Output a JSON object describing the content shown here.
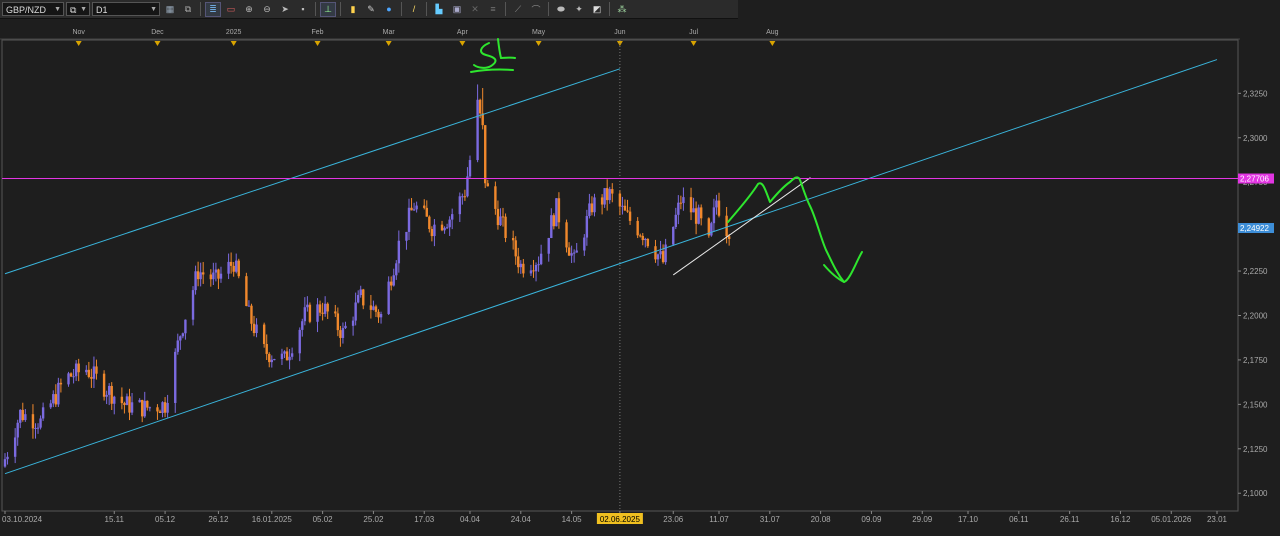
{
  "toolbar": {
    "symbol": "GBP/NZD",
    "timeframe": "D1",
    "buttons": [
      {
        "name": "chart-type-icon",
        "glyph": "▦",
        "color": "#9ab"
      },
      {
        "name": "link-icon",
        "glyph": "⧉",
        "color": "#aaa"
      },
      {
        "sep": true
      },
      {
        "name": "indicators-icon",
        "glyph": "≣",
        "color": "#6fa8dc",
        "active": true
      },
      {
        "name": "templates-icon",
        "glyph": "▭",
        "color": "#e06060"
      },
      {
        "name": "zoom-in-icon",
        "glyph": "⊕",
        "color": "#bbb"
      },
      {
        "name": "zoom-out-icon",
        "glyph": "⊖",
        "color": "#bbb"
      },
      {
        "name": "autoscroll-icon",
        "glyph": "➤",
        "color": "#bbb"
      },
      {
        "name": "grid-icon",
        "glyph": "▪",
        "color": "#bbb"
      },
      {
        "sep": true
      },
      {
        "name": "cursor-icon",
        "glyph": "⊥",
        "color": "#9f9",
        "active": true
      },
      {
        "sep": true
      },
      {
        "name": "text-icon",
        "glyph": "▮",
        "color": "#ffd24d"
      },
      {
        "name": "pencil-icon",
        "glyph": "✎",
        "color": "#ccc"
      },
      {
        "name": "globe-icon",
        "glyph": "●",
        "color": "#4da6ff"
      },
      {
        "sep": true
      },
      {
        "name": "brush-icon",
        "glyph": "/",
        "color": "#ffdd66"
      },
      {
        "sep": true
      },
      {
        "name": "trade-icon",
        "glyph": "▙",
        "color": "#6cf"
      },
      {
        "name": "window-icon",
        "glyph": "▣",
        "color": "#aac"
      },
      {
        "name": "cross-icon",
        "glyph": "✕",
        "color": "#666"
      },
      {
        "name": "channel-icon",
        "glyph": "≡",
        "color": "#777"
      },
      {
        "sep": true
      },
      {
        "name": "fibo-icon",
        "glyph": "⟋",
        "color": "#888"
      },
      {
        "name": "gann-icon",
        "glyph": "⌒",
        "color": "#888"
      },
      {
        "sep": true
      },
      {
        "name": "shape-icon",
        "glyph": "⬬",
        "color": "#bbb"
      },
      {
        "name": "arrow-icon",
        "glyph": "✦",
        "color": "#bbb"
      },
      {
        "name": "eraser-icon",
        "glyph": "◩",
        "color": "#ddd"
      },
      {
        "sep": true
      },
      {
        "name": "expert-icon",
        "glyph": "⁂",
        "color": "#9c9"
      }
    ]
  },
  "chart": {
    "symbol": "GBP/NZD",
    "timeframe": "D1",
    "colors": {
      "background": "#1e1e1e",
      "bull": "#7b6ae0",
      "bear": "#f0882c",
      "channel": "#3ab5dc",
      "level": "#e235e2",
      "trend": "#e8e8e8",
      "drawing": "#2ee62e",
      "current_price_tag": "#3d8ed8"
    },
    "price_axis": {
      "min": 2.09,
      "max": 2.355,
      "tick_labels": [
        "2,3250",
        "2,3000",
        "2,2750",
        "2,2500",
        "2,2250",
        "2,2000",
        "2,1750",
        "2,1500",
        "2,1250",
        "2,1000"
      ],
      "tick_values": [
        2.325,
        2.3,
        2.275,
        2.25,
        2.225,
        2.2,
        2.175,
        2.15,
        2.125,
        2.1
      ]
    },
    "horizontal_level": {
      "value": 2.27706,
      "label": "2,27706"
    },
    "current_price": {
      "value": 2.24922,
      "label": "2,24922"
    },
    "x_axis": {
      "start_date": "03.10.2024",
      "highlight_date": "02.06.2025",
      "labels": [
        {
          "text": "03.10.2024",
          "date": "2024-10-03"
        },
        {
          "text": "15.11",
          "date": "2024-11-15"
        },
        {
          "text": "05.12",
          "date": "2024-12-05"
        },
        {
          "text": "26.12",
          "date": "2024-12-26"
        },
        {
          "text": "16.01.2025",
          "date": "2025-01-16"
        },
        {
          "text": "05.02",
          "date": "2025-02-05"
        },
        {
          "text": "25.02",
          "date": "2025-02-25"
        },
        {
          "text": "17.03",
          "date": "2025-03-17"
        },
        {
          "text": "04.04",
          "date": "2025-04-04"
        },
        {
          "text": "24.04",
          "date": "2025-04-24"
        },
        {
          "text": "14.05",
          "date": "2025-05-14"
        },
        {
          "text": "02.06.2025",
          "date": "2025-06-02",
          "highlight": true
        },
        {
          "text": "23.06",
          "date": "2025-06-23"
        },
        {
          "text": "11.07",
          "date": "2025-07-11"
        },
        {
          "text": "31.07",
          "date": "2025-07-31"
        },
        {
          "text": "20.08",
          "date": "2025-08-20"
        },
        {
          "text": "09.09",
          "date": "2025-09-09"
        },
        {
          "text": "29.09",
          "date": "2025-09-29"
        },
        {
          "text": "17.10",
          "date": "2025-10-17"
        },
        {
          "text": "06.11",
          "date": "2025-11-06"
        },
        {
          "text": "26.11",
          "date": "2025-11-26"
        },
        {
          "text": "16.12",
          "date": "2025-12-16"
        },
        {
          "text": "05.01.2026",
          "date": "2026-01-05"
        },
        {
          "text": "23.01",
          "date": "2026-01-23"
        }
      ]
    },
    "period_markers": [
      {
        "label": "Nov",
        "date": "2024-11-01"
      },
      {
        "label": "Dec",
        "date": "2024-12-02"
      },
      {
        "label": "2025",
        "date": "2025-01-01"
      },
      {
        "label": "Feb",
        "date": "2025-02-03"
      },
      {
        "label": "Mar",
        "date": "2025-03-03"
      },
      {
        "label": "Apr",
        "date": "2025-04-01"
      },
      {
        "label": "May",
        "date": "2025-05-01"
      },
      {
        "label": "Jun",
        "date": "2025-06-02"
      },
      {
        "label": "Jul",
        "date": "2025-07-01"
      },
      {
        "label": "Aug",
        "date": "2025-08-01"
      }
    ],
    "channel_lines": [
      {
        "from": {
          "date": "2024-10-03",
          "value": 2.111
        },
        "to": {
          "date": "2026-01-23",
          "value": 2.344
        }
      },
      {
        "from": {
          "date": "2024-10-03",
          "value": 2.2235
        },
        "to": {
          "date": "2025-06-02",
          "value": 2.3388
        }
      }
    ],
    "trend_line": {
      "from": {
        "date": "2025-06-23",
        "value": 2.2228
      },
      "to": {
        "date": "2025-08-16",
        "value": 2.2776
      }
    },
    "annotation_text": "SL",
    "price_path": [
      {
        "date": "2024-10-03",
        "value": 2.115
      },
      {
        "date": "2024-10-10",
        "value": 2.145
      },
      {
        "date": "2024-10-18",
        "value": 2.14
      },
      {
        "date": "2024-10-28",
        "value": 2.165
      },
      {
        "date": "2024-11-05",
        "value": 2.17
      },
      {
        "date": "2024-11-12",
        "value": 2.16
      },
      {
        "date": "2024-11-20",
        "value": 2.15
      },
      {
        "date": "2024-11-28",
        "value": 2.148
      },
      {
        "date": "2024-12-06",
        "value": 2.15
      },
      {
        "date": "2024-12-12",
        "value": 2.19
      },
      {
        "date": "2024-12-19",
        "value": 2.225
      },
      {
        "date": "2024-12-26",
        "value": 2.22
      },
      {
        "date": "2025-01-02",
        "value": 2.23
      },
      {
        "date": "2025-01-08",
        "value": 2.2
      },
      {
        "date": "2025-01-14",
        "value": 2.18
      },
      {
        "date": "2025-01-22",
        "value": 2.175
      },
      {
        "date": "2025-01-30",
        "value": 2.2
      },
      {
        "date": "2025-02-06",
        "value": 2.205
      },
      {
        "date": "2025-02-14",
        "value": 2.19
      },
      {
        "date": "2025-02-21",
        "value": 2.21
      },
      {
        "date": "2025-03-01",
        "value": 2.2
      },
      {
        "date": "2025-03-08",
        "value": 2.24
      },
      {
        "date": "2025-03-14",
        "value": 2.262
      },
      {
        "date": "2025-03-21",
        "value": 2.25
      },
      {
        "date": "2025-03-28",
        "value": 2.255
      },
      {
        "date": "2025-04-03",
        "value": 2.27
      },
      {
        "date": "2025-04-07",
        "value": 2.305
      },
      {
        "date": "2025-04-12",
        "value": 2.27
      },
      {
        "date": "2025-04-18",
        "value": 2.25
      },
      {
        "date": "2025-04-25",
        "value": 2.228
      },
      {
        "date": "2025-05-02",
        "value": 2.232
      },
      {
        "date": "2025-05-09",
        "value": 2.26
      },
      {
        "date": "2025-05-16",
        "value": 2.23
      },
      {
        "date": "2025-05-23",
        "value": 2.262
      },
      {
        "date": "2025-05-30",
        "value": 2.268
      },
      {
        "date": "2025-06-06",
        "value": 2.255
      },
      {
        "date": "2025-06-13",
        "value": 2.245
      },
      {
        "date": "2025-06-20",
        "value": 2.23
      },
      {
        "date": "2025-06-27",
        "value": 2.265
      },
      {
        "date": "2025-07-04",
        "value": 2.255
      },
      {
        "date": "2025-07-08",
        "value": 2.24
      },
      {
        "date": "2025-07-11",
        "value": 2.265
      },
      {
        "date": "2025-07-15",
        "value": 2.249
      }
    ]
  }
}
